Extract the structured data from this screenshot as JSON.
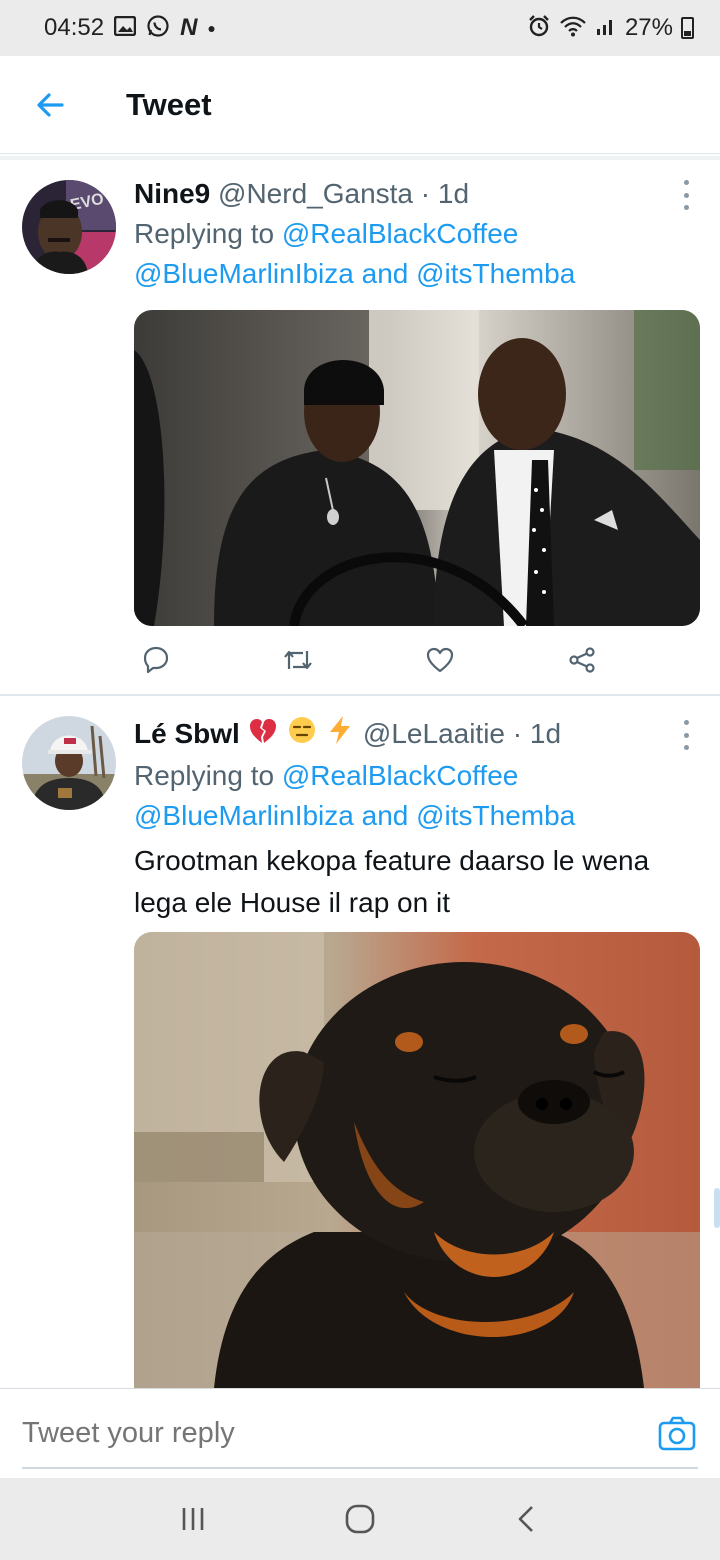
{
  "status_bar": {
    "time": "04:52",
    "left_icons": [
      "gallery-icon",
      "whatsapp-icon",
      "n-icon"
    ],
    "right_icons": [
      "alarm-icon",
      "wifi-icon",
      "signal-icon"
    ],
    "battery": "27%"
  },
  "header": {
    "title": "Tweet",
    "back_icon": "back-arrow-icon"
  },
  "tweets": [
    {
      "name": "Nine9",
      "handle": "@Nerd_Gansta",
      "time": "· 1d",
      "replying_prefix": "Replying to",
      "reply_to_1": "@RealBlackCoffee",
      "reply_to_2": "@BlueMarlinIbiza",
      "reply_and": "and",
      "reply_to_3": "@itsThemba",
      "text": "",
      "media": "photo of two men in suits",
      "actions": [
        "reply-icon",
        "retweet-icon",
        "like-icon",
        "share-icon"
      ]
    },
    {
      "name": "Lé Sbwl",
      "emojis": [
        "broken-heart-emoji",
        "expressionless-face-emoji",
        "lightning-emoji"
      ],
      "handle": "@LeLaaitie",
      "time": "· 1d",
      "replying_prefix": "Replying to",
      "reply_to_1": "@RealBlackCoffee",
      "reply_to_2": "@BlueMarlinIbiza",
      "reply_and": "and",
      "reply_to_3": "@itsThemba",
      "text_line_1": "Grootman kekopa feature daarso le wena",
      "text_line_2": "lega ele House il rap on it",
      "media": "photo of a rottweiler dog"
    }
  ],
  "reply_bar": {
    "placeholder": "Tweet your reply",
    "camera_icon": "camera-icon"
  },
  "nav_bar": {
    "buttons": [
      "recents-icon",
      "home-icon",
      "back-icon"
    ]
  },
  "colors": {
    "link": "#1d9bf0",
    "text": "#0f1419",
    "muted": "#536471",
    "bars": "#ebebeb"
  }
}
